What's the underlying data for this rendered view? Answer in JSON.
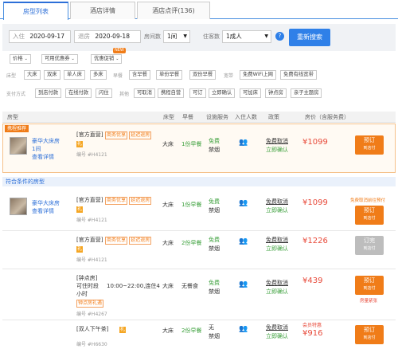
{
  "tabs": [
    "房型列表",
    "酒店详情",
    "酒店点评(136)"
  ],
  "search": {
    "checkin_label": "入住",
    "checkin": "2020-09-17",
    "checkout_label": "退房",
    "checkout": "2020-09-18",
    "rooms_label": "房间数",
    "rooms": "1间",
    "guests_label": "住客数",
    "guests": "1成人",
    "help": "?",
    "button": "重新搜索"
  },
  "filters": {
    "price": "价格",
    "discount": "可用优惠券",
    "promo": "优惠促销",
    "promo_badge": "NEW",
    "bed_label": "床型",
    "beds": [
      "大床",
      "双床",
      "单人床",
      "多床"
    ],
    "meal_label": "早餐",
    "meals": [
      "含早餐",
      "单份早餐",
      "双份早餐"
    ],
    "wifi_label": "宽带",
    "wifi": [
      "免费WiFi上网",
      "免费有线宽带"
    ],
    "pay_label": "支付方式",
    "pays": [
      "到店付款",
      "在线付款",
      "闪住"
    ],
    "other_label": "其他",
    "others": [
      "可取消",
      "携程自营",
      "可订",
      "立即确认",
      "可加床",
      "钟点房",
      "亲子主题房"
    ]
  },
  "headers": [
    "房型",
    "床型",
    "早餐",
    "设施服务",
    "入住人数",
    "政策",
    "房价（含服务费）"
  ],
  "recommended": {
    "section": "携程推荐",
    "room_name": "豪华大床房",
    "room_count": "1间",
    "detail": "查看详情",
    "provider": "[官方直营]",
    "tag1": "商务优享",
    "tag2": "延迟退房",
    "code": "编号 #H4121",
    "bed": "大床",
    "meal": "1份早餐",
    "wifi": "免费",
    "smoke": "禁烟",
    "cancel": "免费取消",
    "confirm": "立即确认",
    "price": "¥1099",
    "book": "预订",
    "book_sub": "到店付"
  },
  "matching_section": "符合条件的房型",
  "rows": [
    {
      "room_name": "豪华大床房",
      "detail": "查看详情",
      "provider": "[官方直营]",
      "tag1": "商务优享",
      "tag2": "延迟退房",
      "code": "编号 #H4121",
      "bed": "大床",
      "meal": "1份早餐",
      "wifi": "免费",
      "smoke": "禁烟",
      "cancel": "免费取消",
      "confirm": "立即确认",
      "note": "免费取消前往预付",
      "price": "¥1099",
      "book": "预订",
      "book_sub": "到店付"
    },
    {
      "provider": "[官方直营]",
      "tag1": "商务优享",
      "tag2": "延迟退房",
      "code": "编号 #H4121",
      "bed": "大床",
      "meal": "2份早餐",
      "wifi": "免费",
      "smoke": "禁烟",
      "cancel": "免费取消",
      "confirm": "立即确认",
      "price": "¥1226",
      "book": "订完",
      "book_sub": "到店付"
    },
    {
      "provider": "[钟点房]",
      "line2": "可住时段",
      "time": "10:00~22:00,连住4",
      "hours": "小时",
      "tag1": "钟点房礼遇",
      "code": "编号 #H4267",
      "bed": "大床",
      "meal": "无餐食",
      "wifi": "免费",
      "smoke": "禁烟",
      "cancel": "免费取消",
      "confirm": "立即确认",
      "price": "¥439",
      "book": "预订",
      "book_sub": "到店付",
      "note": "房量紧张"
    },
    {
      "provider": "[双人下午茶]",
      "code": "编号 #H6630",
      "bed": "大床",
      "meal": "2份早餐",
      "wifi": "无",
      "smoke": "禁烟",
      "cancel": "免费取消",
      "confirm": "立即确认",
      "member": "会员特惠",
      "price": "¥916",
      "book": "预订",
      "book_sub": "到店付"
    }
  ]
}
